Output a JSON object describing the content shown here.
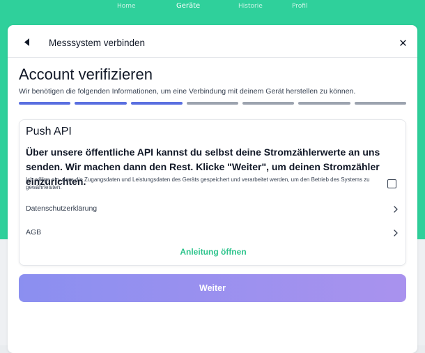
{
  "nav": {
    "items": [
      {
        "label": "Home",
        "active": false
      },
      {
        "label": "Geräte",
        "active": true
      },
      {
        "label": "Historie",
        "active": false
      },
      {
        "label": "Profil",
        "active": false
      }
    ]
  },
  "modal": {
    "title": "Messsystem verbinden",
    "heading": "Account verifizieren",
    "subheading": "Wir benötigen die folgenden Informationen, um eine Verbindung mit deinem Gerät herstellen zu können.",
    "steps_total": 7,
    "steps_completed": 3,
    "card": {
      "title": "Push API",
      "description": "Über unsere öffentliche API kannst du selbst deine Stromzählerwerte an uns senden. Wir machen dann den Rest. Klicke \"Weiter\", um deinen Stromzähler einzurichten.",
      "consent": "Ich willige ein, dass die Zugangsdaten und Leistungsdaten des Geräts gespeichert und verarbeitet werden, um den Betrieb des Systems zu gewährleisten.",
      "consent_checked": false,
      "links": [
        {
          "label": "Datenschutzerklärung"
        },
        {
          "label": "AGB"
        }
      ],
      "guide_link": "Anleitung öffnen"
    },
    "primary_button": "Weiter"
  },
  "colors": {
    "brand_green": "#2fd09b",
    "step_done": "#5a6fe0",
    "step_todo": "#9ca3af",
    "button_gradient_start": "#8b8ff0",
    "button_gradient_end": "#a992ee"
  },
  "icons": {
    "back": "triangle-left-icon",
    "close": "close-icon",
    "chevron": "chevron-right-icon"
  }
}
